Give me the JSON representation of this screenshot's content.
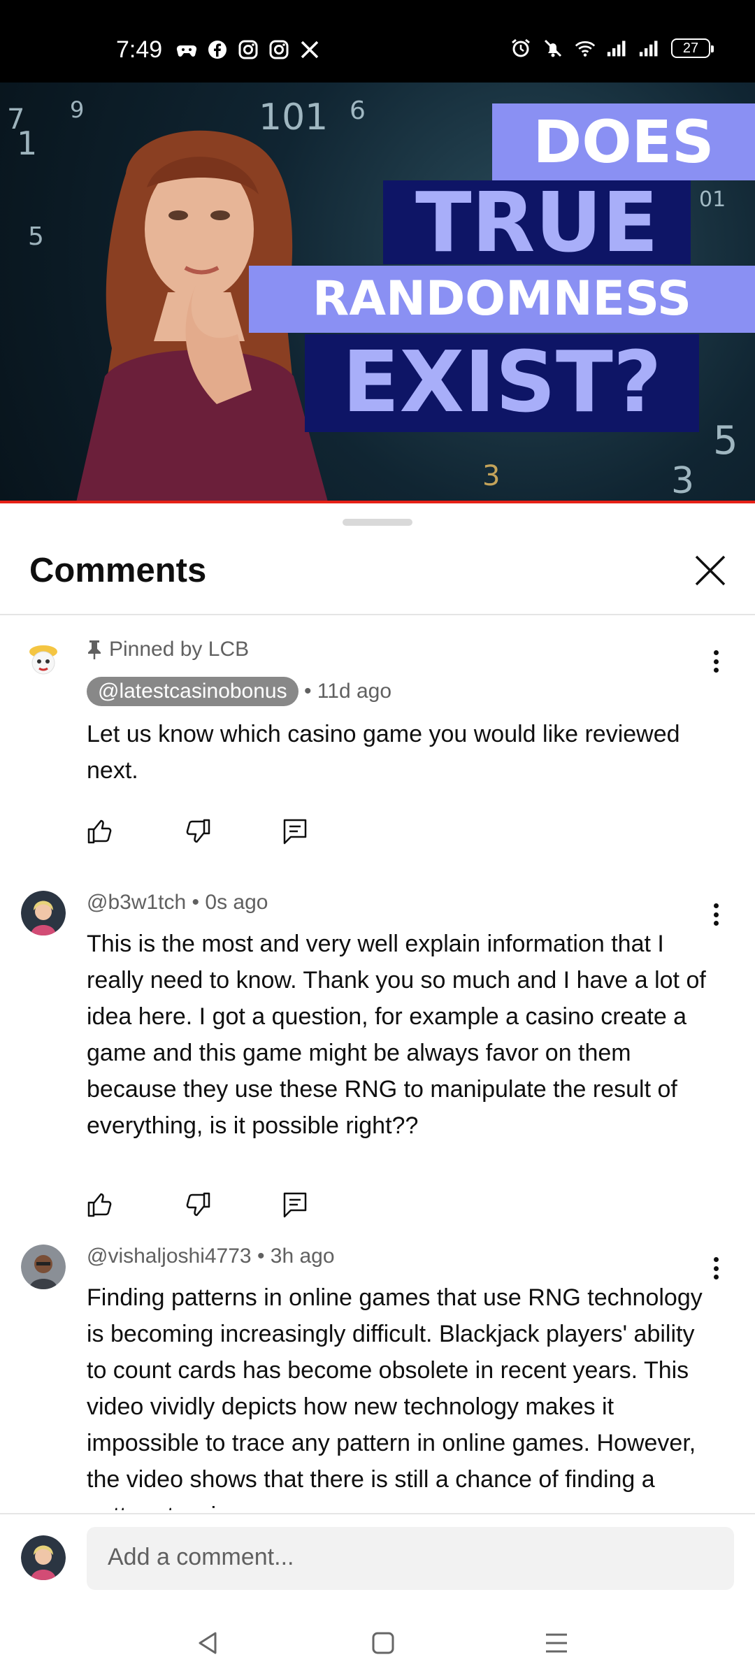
{
  "status_bar": {
    "time": "7:49",
    "left_icons": [
      "game-controller-icon",
      "facebook-icon",
      "instagram-icon",
      "instagram-icon",
      "x-icon"
    ],
    "right_icons": [
      "alarm-icon",
      "mute-icon",
      "wifi-icon",
      "signal-icon",
      "signal-icon"
    ],
    "battery": "27"
  },
  "video": {
    "title_lines": [
      "DOES",
      "TRUE",
      "RANDOMNESS",
      "EXIST?"
    ],
    "accent_color": "#8a90f3",
    "progress_color": "#e62117"
  },
  "comments_panel": {
    "title": "Comments",
    "close_label": "close"
  },
  "comments": [
    {
      "pinned_label": "Pinned by LCB",
      "author": "@latestcasinobonus",
      "time": "• 11d ago",
      "text": "Let us know which casino game you would like reviewed next."
    },
    {
      "author": "@b3w1tch",
      "time": "• 0s ago",
      "text": "This is the most and very well explain information that I really need to know. Thank you so much and I have a lot of idea here. I got a question, for example a casino create a game and this game might be always favor on them because they use these RNG to manipulate the result of everything, is it possible right??"
    },
    {
      "author": "@vishaljoshi4773",
      "time": "• 3h ago",
      "text": "Finding patterns in online games that use RNG technology is becoming increasingly difficult. Blackjack players' ability to count cards has become obsolete in recent years. This video vividly depicts how new technology makes it impossible to trace any pattern in online games. However, the video shows that there is still a chance of finding a pattern to win a"
    }
  ],
  "add_comment": {
    "placeholder": "Add a comment..."
  },
  "nav": {
    "back": "back-icon",
    "home": "home-icon",
    "recents": "menu-icon"
  }
}
